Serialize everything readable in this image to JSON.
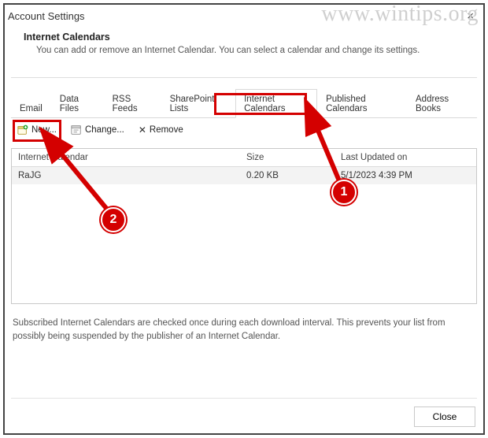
{
  "window": {
    "title": "Account Settings",
    "watermark": "www.wintips.org",
    "close_x": "×"
  },
  "section": {
    "title": "Internet Calendars",
    "description": "You can add or remove an Internet Calendar. You can select a calendar and change its settings."
  },
  "tabs": {
    "email": "Email",
    "data_files": "Data Files",
    "rss_feeds": "RSS Feeds",
    "sharepoint": "SharePoint Lists",
    "internet_calendars": "Internet Calendars",
    "published": "Published Calendars",
    "address_books": "Address Books"
  },
  "toolbar": {
    "new_label": "New...",
    "change_label": "Change...",
    "remove_label": "Remove",
    "remove_glyph": "✕"
  },
  "table": {
    "headers": {
      "name": "Internet Calendar",
      "size": "Size",
      "updated": "Last Updated on"
    },
    "rows": [
      {
        "name": "RaJG",
        "size": "0.20 KB",
        "updated": "5/1/2023 4:39 PM"
      }
    ]
  },
  "footer_note": "Subscribed Internet Calendars are checked once during each download interval. This prevents your list from possibly being suspended by the publisher of an Internet Calendar.",
  "buttons": {
    "close": "Close"
  },
  "callouts": {
    "one": "1",
    "two": "2"
  }
}
